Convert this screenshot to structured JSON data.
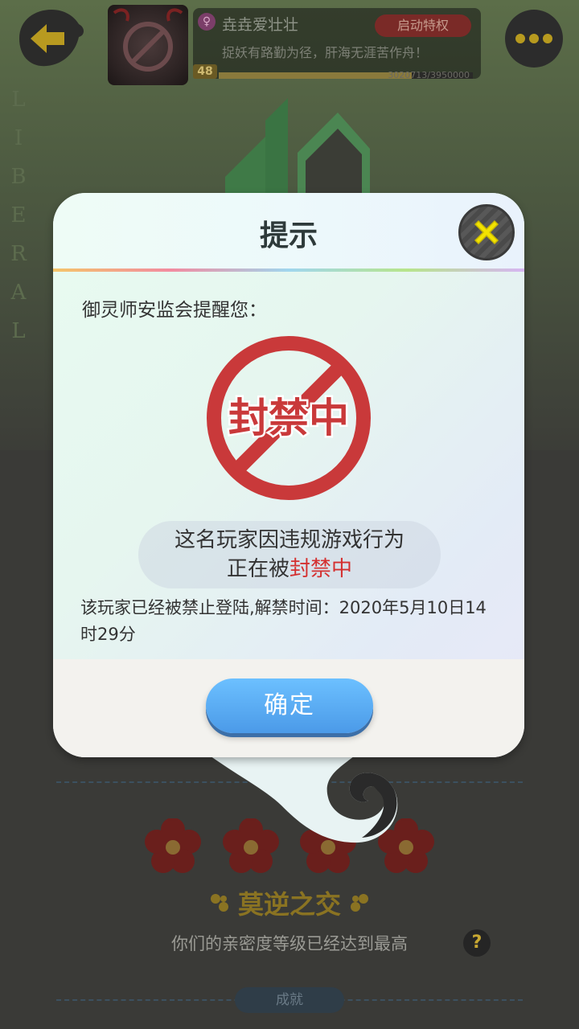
{
  "background": {
    "vertical_text": [
      "L",
      "I",
      "B",
      "E",
      "R",
      "A",
      "L"
    ]
  },
  "player": {
    "name": "垚垚爱壮壮",
    "gender_symbol": "♀",
    "privilege_label": "启动特权",
    "motto": "捉妖有路勤为径，肝海无涯苦作舟！",
    "level": "48",
    "exp_text": "3020713/3950000",
    "exp_fraction": 0.76
  },
  "modal": {
    "title": "提示",
    "notice_title": "御灵师安监会提醒您：",
    "stamp_text": "封禁中",
    "ban_line1": "这名玩家因违规游戏行为",
    "ban_line2_prefix": "正在被",
    "ban_line2_highlight": "封禁中",
    "unban_text": "该玩家已经被禁止登陆,解禁时间：2020年5月10日14时29分",
    "confirm_label": "确定"
  },
  "friendship": {
    "title": "莫逆之交",
    "intimacy_text": "你们的亲密度等级已经达到最高",
    "help_symbol": "?",
    "achievement_tab": "成就"
  },
  "colors": {
    "ban_red": "#c9393a",
    "confirm_blue": "#4b9ae8",
    "gold": "#b79a1f"
  }
}
